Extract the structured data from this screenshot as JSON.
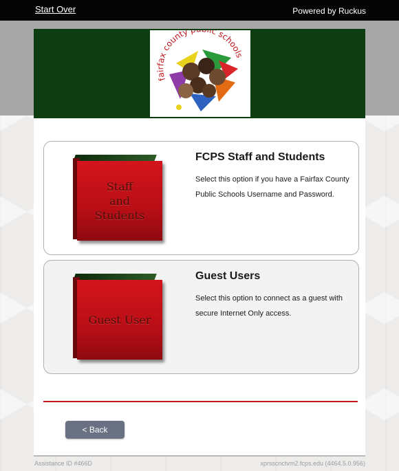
{
  "topbar": {
    "start_over": "Start Over",
    "powered_by": "Powered by Ruckus"
  },
  "header": {
    "logo_text": "fairfax county public schools",
    "logo_icon": "fcps-logo-icon"
  },
  "options": [
    {
      "book_label": "Staff\nand\nStudents",
      "title": "FCPS Staff and Students",
      "description": "Select this option if you have a Fairfax County Public Schools Username and Password."
    },
    {
      "book_label": "Guest User",
      "title": "Guest Users",
      "description": "Select this option to connect as a guest with secure Internet Only access."
    }
  ],
  "back_button": "< Back",
  "footer": {
    "assistance_id": "Assistance ID #466D",
    "server": "xprsscnctvm2.fcps.edu (4464.5.0.956)"
  },
  "colors": {
    "header_green": "#0f3d12",
    "divider_red": "#c0151b",
    "button_grey": "#6a7183"
  }
}
